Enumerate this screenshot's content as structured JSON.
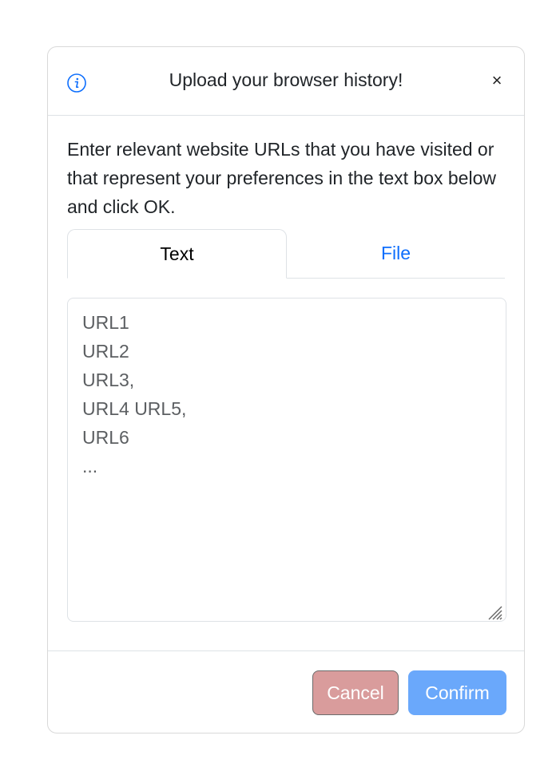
{
  "modal": {
    "title": "Upload your browser history!",
    "close_label": "×",
    "info_icon": "info-circle-icon",
    "description": "Enter relevant website URLs that you have visited or that represent your preferences in the text box below and click OK.",
    "tabs": [
      {
        "label": "Text",
        "active": true
      },
      {
        "label": "File",
        "active": false
      }
    ],
    "textarea": {
      "value": "",
      "placeholder": "URL1\nURL2\nURL3,\nURL4 URL5,\nURL6\n..."
    },
    "buttons": {
      "cancel_label": "Cancel",
      "confirm_label": "Confirm"
    }
  },
  "colors": {
    "accent": "#0d6efd",
    "cancel_bg": "#d99c9c",
    "confirm_bg": "#6aa8fb",
    "border": "#dee2e6"
  }
}
